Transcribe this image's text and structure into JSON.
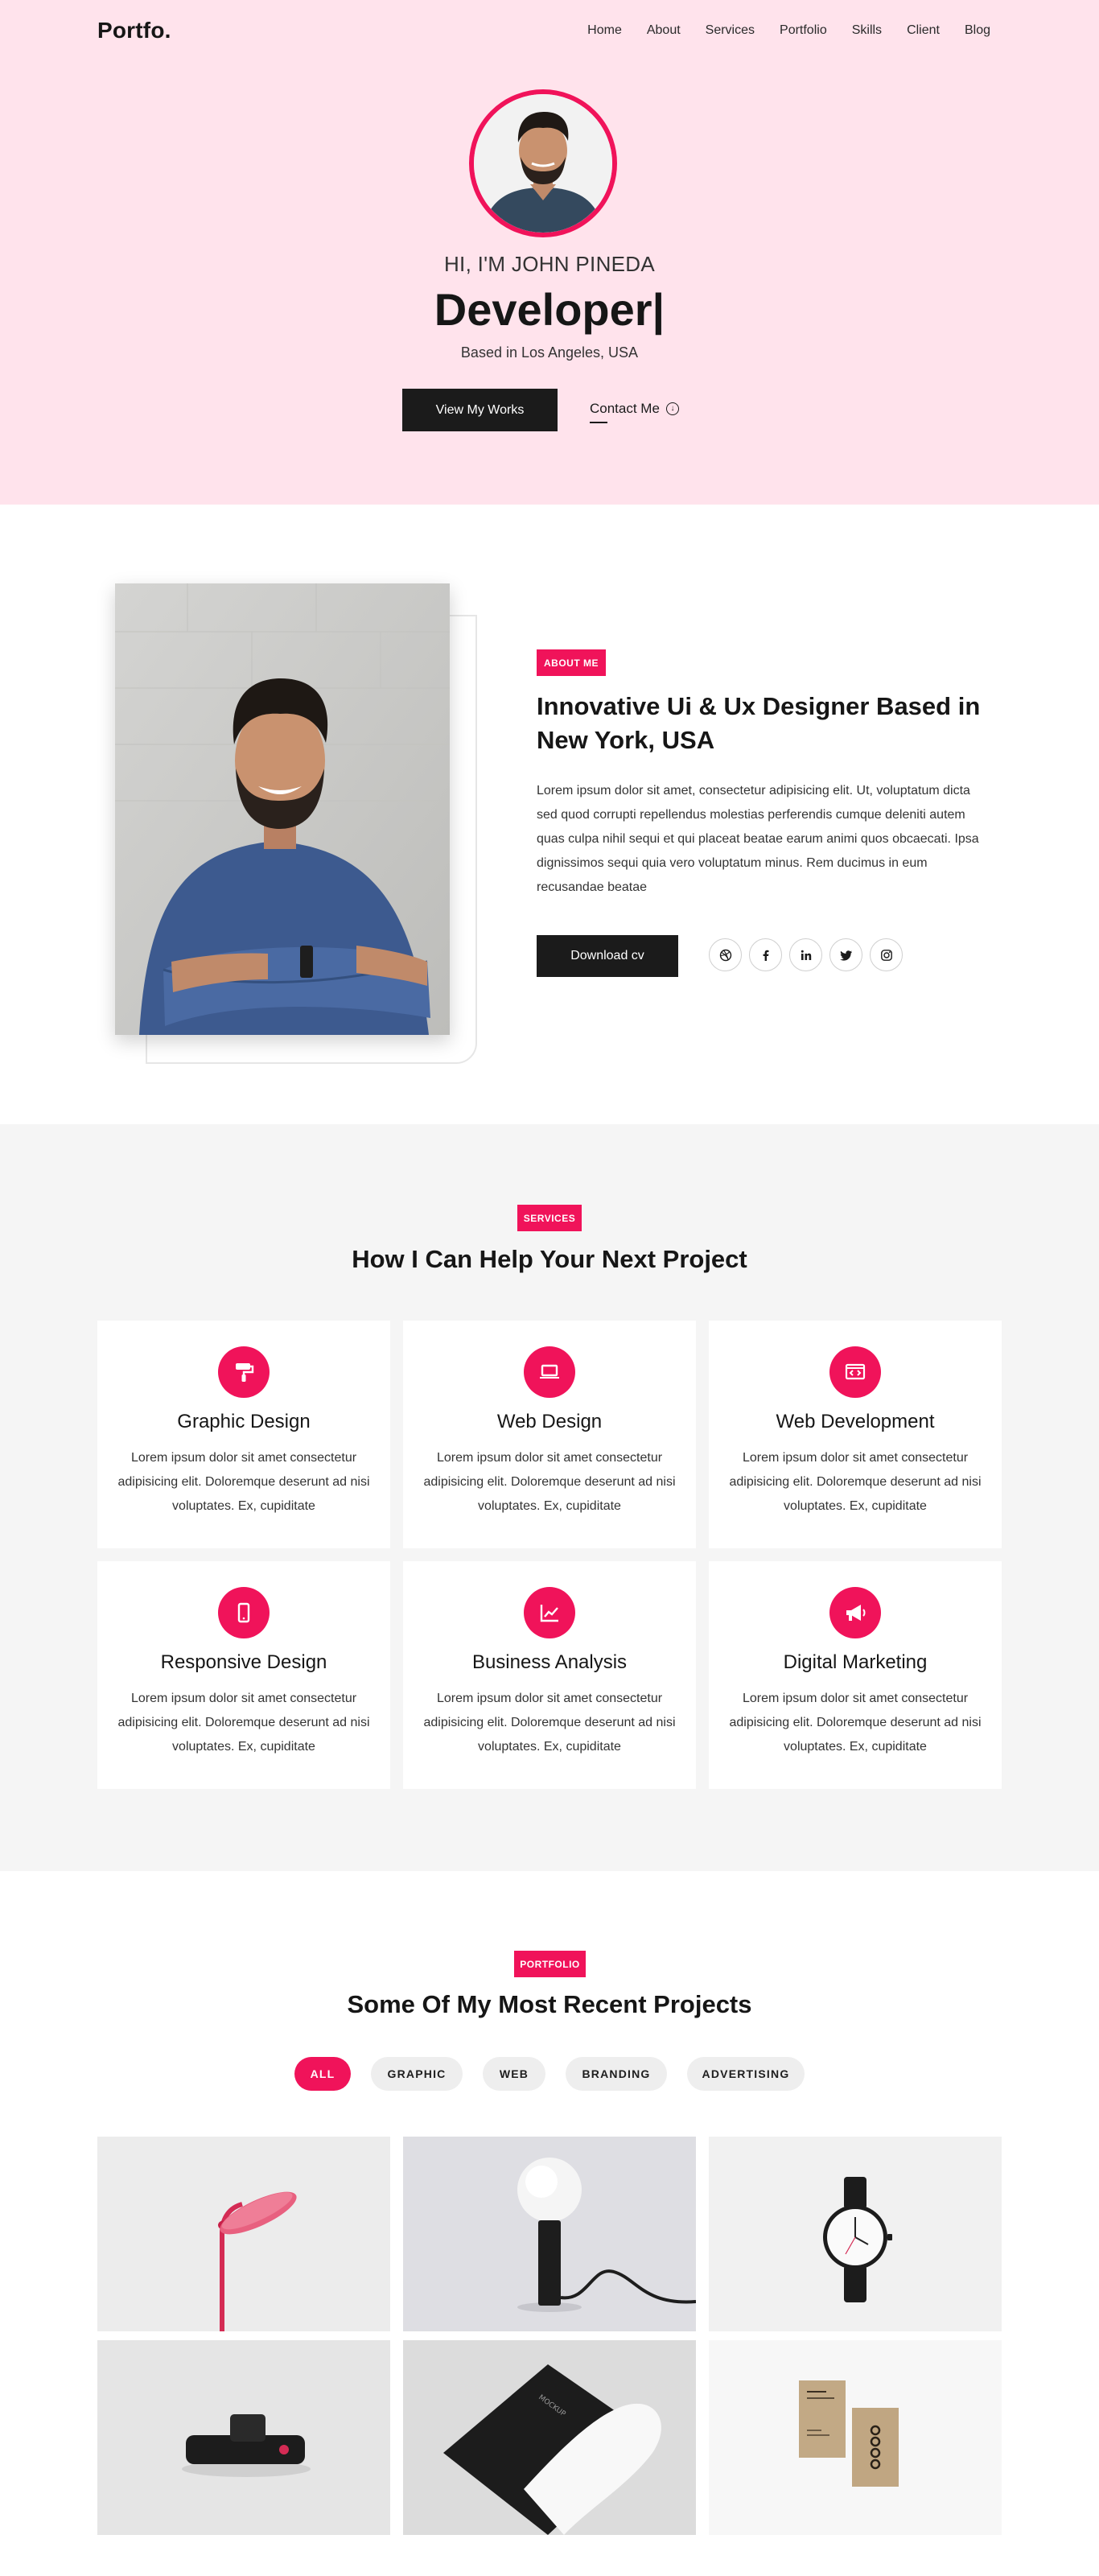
{
  "nav": {
    "logo": "Portfo.",
    "items": [
      "Home",
      "About",
      "Services",
      "Portfolio",
      "Skills",
      "Client",
      "Blog"
    ]
  },
  "hero": {
    "greeting": "HI, I'M JOHN PINEDA",
    "title": "Developer|",
    "location": "Based in Los Angeles, USA",
    "primary_button": "View My Works",
    "contact_link": "Contact Me"
  },
  "about": {
    "tag": "ABOUT ME",
    "title": "Innovative Ui & Ux Designer Based in New York, USA",
    "text": "Lorem ipsum dolor sit amet, consectetur adipisicing elit. Ut, voluptatum dicta sed quod corrupti repellendus molestias perferendis cumque deleniti autem quas culpa nihil sequi et qui placeat beatae earum animi quos obcaecati. Ipsa dignissimos sequi quia vero voluptatum minus. Rem ducimus in eum recusandae beatae",
    "button": "Download cv",
    "socials": [
      "dribbble-icon",
      "facebook-icon",
      "linkedin-icon",
      "twitter-icon",
      "instagram-icon"
    ]
  },
  "services": {
    "tag": "SERVICES",
    "title": "How I Can Help Your Next Project",
    "items": [
      {
        "title": "Graphic Design",
        "text": "Lorem ipsum dolor sit amet consectetur adipisicing elit. Doloremque deserunt ad nisi voluptates. Ex, cupiditate",
        "icon": "paint-roller-icon"
      },
      {
        "title": "Web Design",
        "text": "Lorem ipsum dolor sit amet consectetur adipisicing elit. Doloremque deserunt ad nisi voluptates. Ex, cupiditate",
        "icon": "laptop-icon"
      },
      {
        "title": "Web Development",
        "text": "Lorem ipsum dolor sit amet consectetur adipisicing elit. Doloremque deserunt ad nisi voluptates. Ex, cupiditate",
        "icon": "code-window-icon"
      },
      {
        "title": "Responsive Design",
        "text": "Lorem ipsum dolor sit amet consectetur adipisicing elit. Doloremque deserunt ad nisi voluptates. Ex, cupiditate",
        "icon": "mobile-icon"
      },
      {
        "title": "Business Analysis",
        "text": "Lorem ipsum dolor sit amet consectetur adipisicing elit. Doloremque deserunt ad nisi voluptates. Ex, cupiditate",
        "icon": "chart-line-icon"
      },
      {
        "title": "Digital Marketing",
        "text": "Lorem ipsum dolor sit amet consectetur adipisicing elit. Doloremque deserunt ad nisi voluptates. Ex, cupiditate",
        "icon": "megaphone-icon"
      }
    ]
  },
  "portfolio": {
    "tag": "PORTFOLIO",
    "title": "Some Of My Most Recent Projects",
    "filters": [
      "ALL",
      "GRAPHIC",
      "WEB",
      "BRANDING",
      "ADVERTISING"
    ],
    "active_filter": "ALL",
    "projects": [
      "pink-lamp-image",
      "globe-lamp-image",
      "wristwatch-image",
      "black-device-image",
      "folded-paper-image",
      "business-cards-image"
    ]
  },
  "colors": {
    "accent": "#f0135a",
    "hero_bg": "#ffe3ec",
    "dark": "#1b1b1b",
    "services_bg": "#f5f5f5"
  }
}
